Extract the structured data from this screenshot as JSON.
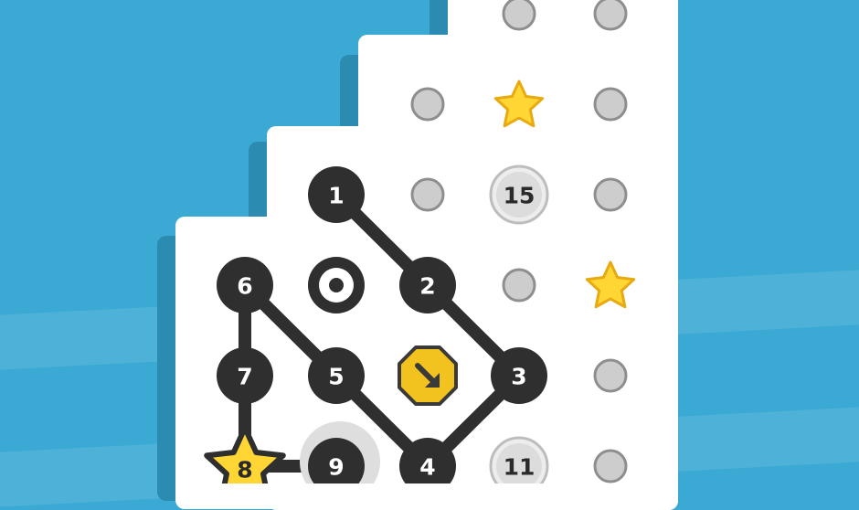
{
  "game": {
    "path_nodes": [
      {
        "label": "1"
      },
      {
        "label": "2"
      },
      {
        "label": "3"
      },
      {
        "label": "4"
      },
      {
        "label": "5"
      },
      {
        "label": "6"
      },
      {
        "label": "7"
      },
      {
        "label": "8"
      },
      {
        "label": "9"
      }
    ],
    "bonus_nodes": [
      {
        "label": "15"
      },
      {
        "label": "11"
      }
    ],
    "colors": {
      "background": "#3aa9d3",
      "board": "#ffffff",
      "path": "#2f2f2f",
      "empty_dot": "#cdcdcd",
      "star": "#ffd634",
      "direction_sign": "#f2c31f"
    },
    "icons": [
      "star-icon",
      "target-icon",
      "direction-arrow-icon"
    ]
  }
}
